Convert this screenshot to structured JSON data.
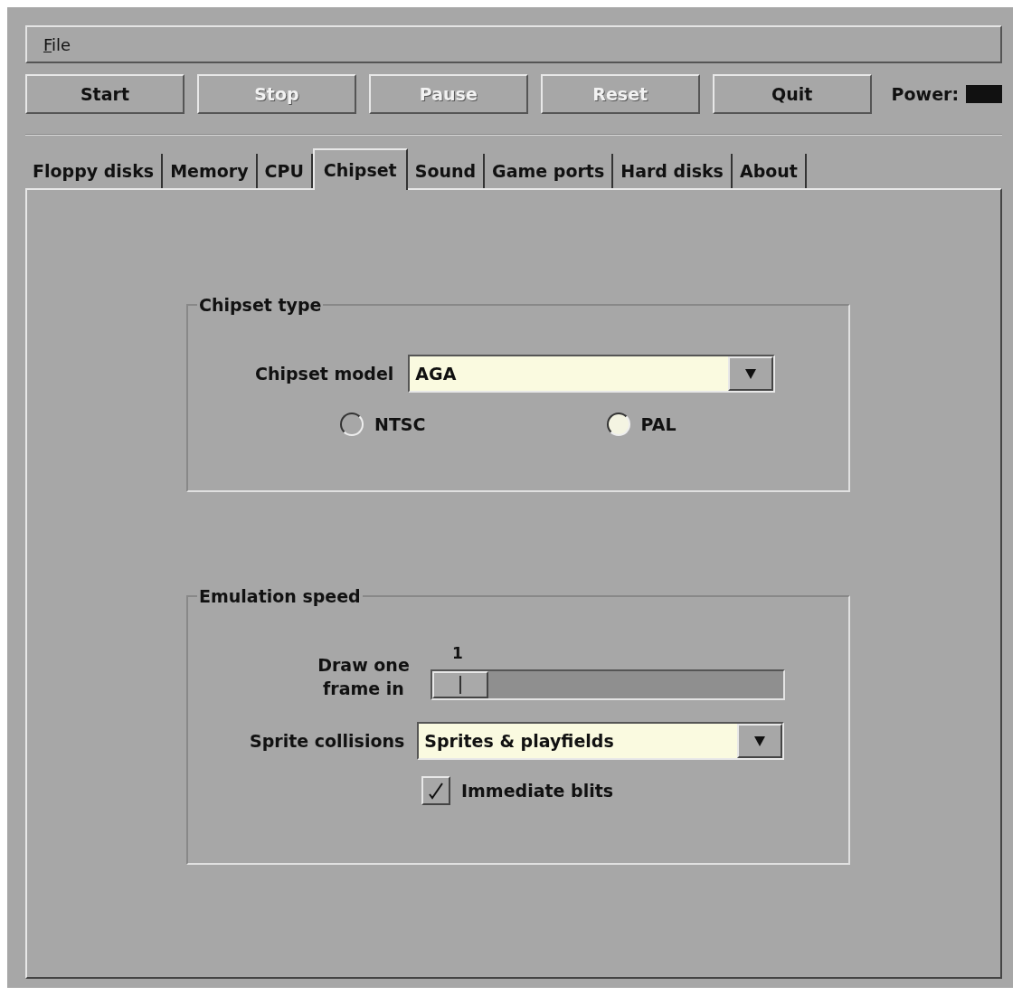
{
  "menu": [
    {
      "label": "File"
    }
  ],
  "buttons": [
    {
      "label": "Start",
      "disabled": false
    },
    {
      "label": "Stop",
      "disabled": true
    },
    {
      "label": "Pause",
      "disabled": true
    },
    {
      "label": "Reset",
      "disabled": true
    },
    {
      "label": "Quit",
      "disabled": false
    }
  ],
  "power": {
    "label": "Power:",
    "on": false
  },
  "tabs": [
    {
      "label": "Floppy disks",
      "selected": false
    },
    {
      "label": "Memory",
      "selected": false
    },
    {
      "label": "CPU",
      "selected": false
    },
    {
      "label": "Chipset",
      "selected": true
    },
    {
      "label": "Sound",
      "selected": false
    },
    {
      "label": "Game ports",
      "selected": false
    },
    {
      "label": "Hard disks",
      "selected": false
    },
    {
      "label": "About",
      "selected": false
    }
  ],
  "chipset_type": {
    "title": "Chipset type",
    "model_label": "Chipset model",
    "model_value": "AGA",
    "radios": [
      {
        "label": "NTSC",
        "selected": false
      },
      {
        "label": "PAL",
        "selected": true
      }
    ]
  },
  "emulation_speed": {
    "title": "Emulation speed",
    "frame_label": "Draw one frame in",
    "frame_reading": "1",
    "level": 0,
    "sprite_label": "Sprite collisions",
    "sprite_value": "Sprites & playfields",
    "immediate_blits": {
      "label": "Immediate blits",
      "checked": true
    }
  }
}
